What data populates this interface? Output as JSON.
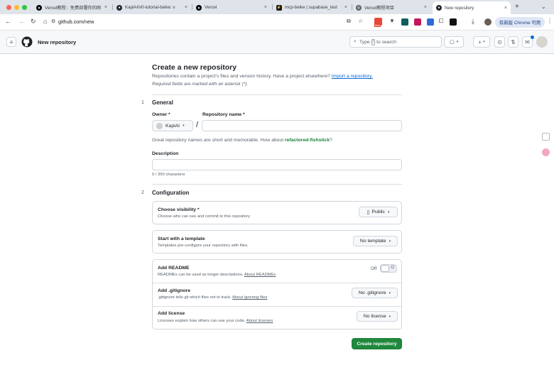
{
  "browser": {
    "tabs": [
      {
        "title": "Vercel教程：免费部署你的网",
        "favicon": "vercel-icon",
        "active": false
      },
      {
        "title": "KapiAI/v0-tutorial-beike: v",
        "favicon": "github-icon",
        "active": false
      },
      {
        "title": "Vercel",
        "favicon": "vercel-icon",
        "active": false
      },
      {
        "title": "mcp-beike | supabase_test",
        "favicon": "supabase-icon",
        "active": false
      },
      {
        "title": "Vercel教程项目",
        "favicon": "globe-icon",
        "active": false
      },
      {
        "title": "New repository",
        "favicon": "github-icon",
        "active": true
      }
    ],
    "url": "github.com/new",
    "update_button": "有新版 Chrome 可用",
    "ext_badge": "New"
  },
  "header": {
    "page_title": "New repository",
    "search_prefix": "Type",
    "search_key": "/",
    "search_suffix": "to search"
  },
  "main": {
    "title": "Create a new repository",
    "subtitle": "Repositories contain a project's files and version history. Have a project elsewhere?",
    "import_link": "Import a repository.",
    "required_note": "Required fields are marked with an asterisk (*).",
    "general": {
      "step": "1",
      "heading": "General",
      "owner_label": "Owner *",
      "owner_value": "KapiAI",
      "repo_name_label": "Repository name *",
      "repo_name_value": "",
      "hint_prefix": "Great repository names are short and memorable. How about",
      "suggestion": "refactored-fishstick",
      "hint_suffix": "?",
      "description_label": "Description",
      "description_value": "",
      "char_counter": "0 / 350 characters"
    },
    "configuration": {
      "step": "2",
      "heading": "Configuration",
      "visibility": {
        "title": "Choose visibility *",
        "desc": "Choose who can see and commit to this repository",
        "value": "Public"
      },
      "template": {
        "title": "Start with a template",
        "desc": "Templates pre-configure your repository with files.",
        "value": "No template"
      },
      "readme": {
        "title": "Add README",
        "desc": "READMEs can be used as longer descriptions.",
        "link": "About READMEs",
        "toggle_state": "Off",
        "toggle_glyph": "O"
      },
      "gitignore": {
        "title": "Add .gitignore",
        "desc": ".gitignore tells git which files not to track.",
        "link": "About ignoring files",
        "value": "No .gitignore"
      },
      "license": {
        "title": "Add license",
        "desc": "Licenses explain how others can use your code.",
        "link": "About licenses",
        "value": "No license"
      }
    },
    "create_button": "Create repository"
  },
  "colors": {
    "primary_green": "#1f883d",
    "link_blue": "#0969da",
    "suggestion_green": "#1a7f37"
  }
}
